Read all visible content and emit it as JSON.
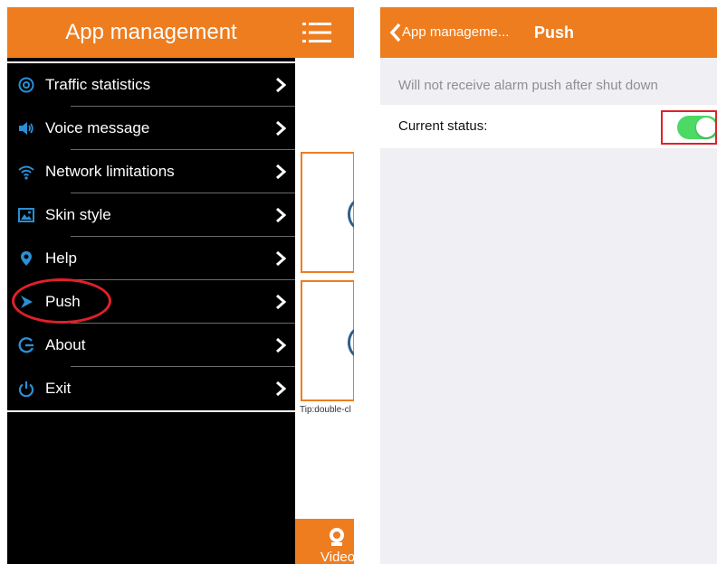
{
  "left": {
    "title": "App management",
    "menu_items": [
      {
        "label": "Traffic statistics",
        "icon": "traffic-icon"
      },
      {
        "label": "Voice message",
        "icon": "speaker-icon"
      },
      {
        "label": "Network limitations",
        "icon": "wifi-icon"
      },
      {
        "label": "Skin style",
        "icon": "image-icon"
      },
      {
        "label": "Help",
        "icon": "location-pin-icon"
      },
      {
        "label": "Push",
        "icon": "push-icon"
      },
      {
        "label": "About",
        "icon": "about-icon"
      },
      {
        "label": "Exit",
        "icon": "power-icon"
      }
    ],
    "background": {
      "tip": "Tip:double-cl",
      "video_label": "Video"
    }
  },
  "right": {
    "back_label": "App manageme...",
    "title": "Push",
    "info": "Will not receive alarm push after shut down",
    "status_label": "Current status:",
    "toggle_on": true
  },
  "colors": {
    "accent": "#ee7d20",
    "menu_icon_blue": "#2a8fd6",
    "toggle_green": "#4cd964",
    "highlight_red": "#e0202a"
  }
}
